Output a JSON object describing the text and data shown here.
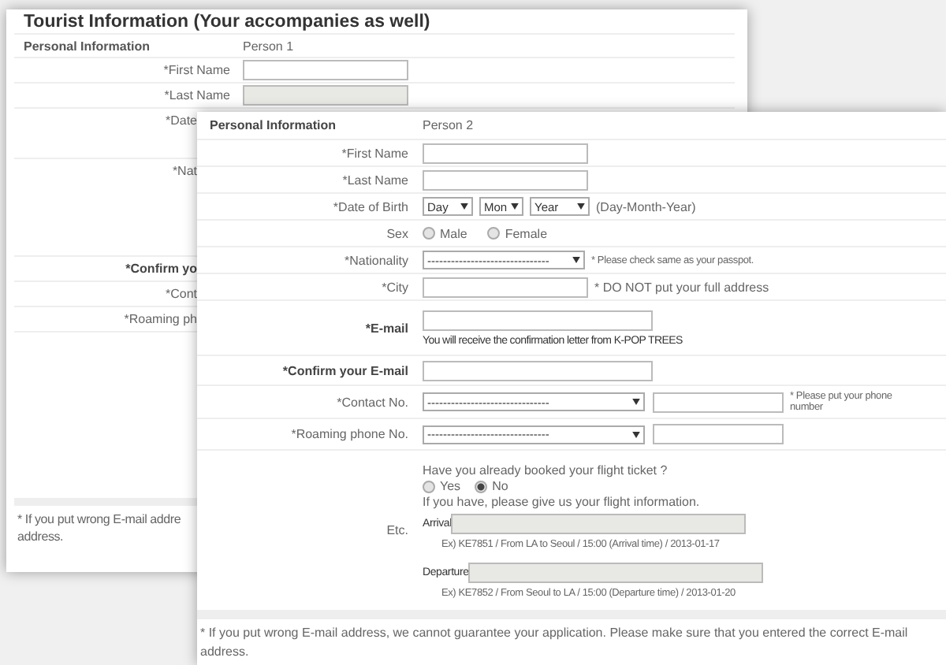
{
  "back_panel": {
    "title": "Tourist Information (Your accompanies as well)",
    "header": {
      "label": "Personal Information",
      "person": "Person 1"
    },
    "rows": [
      {
        "label": "*First Name",
        "kind": "field",
        "bold": false,
        "disabled": false
      },
      {
        "label": "*Last Name",
        "kind": "field",
        "bold": false,
        "disabled": true
      },
      {
        "label": "*Date",
        "kind": "cut-2",
        "bold": false
      },
      {
        "label": "*Nat",
        "kind": "cut-4",
        "bold": false
      },
      {
        "label": "*Confirm yo",
        "kind": "cut-1",
        "bold": true
      },
      {
        "label": "*Cont",
        "kind": "cut-1",
        "bold": false
      },
      {
        "label": "*Roaming ph",
        "kind": "cut-1",
        "bold": false
      }
    ],
    "footnote_lines": [
      "* If you put wrong E-mail addre",
      "address."
    ]
  },
  "front_panel": {
    "header": {
      "label": "Personal Information",
      "person": "Person 2"
    },
    "rows": [
      {
        "kind": "field",
        "label": "*First Name",
        "bold": false
      },
      {
        "kind": "field",
        "label": "*Last Name",
        "bold": false
      },
      {
        "kind": "date",
        "label": "*Date of Birth",
        "bold": false,
        "selects": [
          "Day",
          "Mon",
          "Year"
        ],
        "note": "(Day-Month-Year)"
      },
      {
        "kind": "radio",
        "label": "Sex",
        "bold": false,
        "options": [
          {
            "label": "Male",
            "selected": false
          },
          {
            "label": "Female",
            "selected": false
          }
        ]
      },
      {
        "kind": "select-note",
        "label": "*Nationality",
        "bold": false,
        "select": "-------------------------------",
        "note": "* Please check same as your passpot."
      },
      {
        "kind": "field-note",
        "label": "*City",
        "bold": false,
        "note": "* DO NOT put your full address"
      },
      {
        "kind": "email",
        "label": "*E-mail",
        "bold": true,
        "note": "You will receive the confirmation letter from K-POP TREES"
      },
      {
        "kind": "wide-field",
        "label": "*Confirm your E-mail",
        "bold": true
      },
      {
        "kind": "contact",
        "label": "*Contact No.",
        "bold": false,
        "select": "-------------------------------",
        "note": "* Please put your phone number"
      },
      {
        "kind": "contact",
        "label": "*Roaming phone No.",
        "bold": false,
        "select": "-------------------------------"
      },
      {
        "kind": "flight",
        "label": "Etc.",
        "bold": false,
        "question": "Have you already booked your flight ticket ?",
        "options": [
          {
            "label": "Yes",
            "selected": false
          },
          {
            "label": "No",
            "selected": true
          }
        ],
        "prompt": "If you have, please give us your flight information.",
        "legs": [
          {
            "label": "Arrival",
            "disabled": true,
            "example": "Ex) KE7851 / From LA to Seoul / 15:00 (Arrival time) / 2013-01-17"
          },
          {
            "label": "Departure",
            "disabled": true,
            "example": "Ex) KE7852 / From Seoul to LA / 15:00 (Departure time) / 2013-01-20"
          }
        ]
      }
    ],
    "footnote": "* If you put wrong E-mail address, we cannot guarantee your application. Please make sure that you entered the correct E-mail address."
  }
}
